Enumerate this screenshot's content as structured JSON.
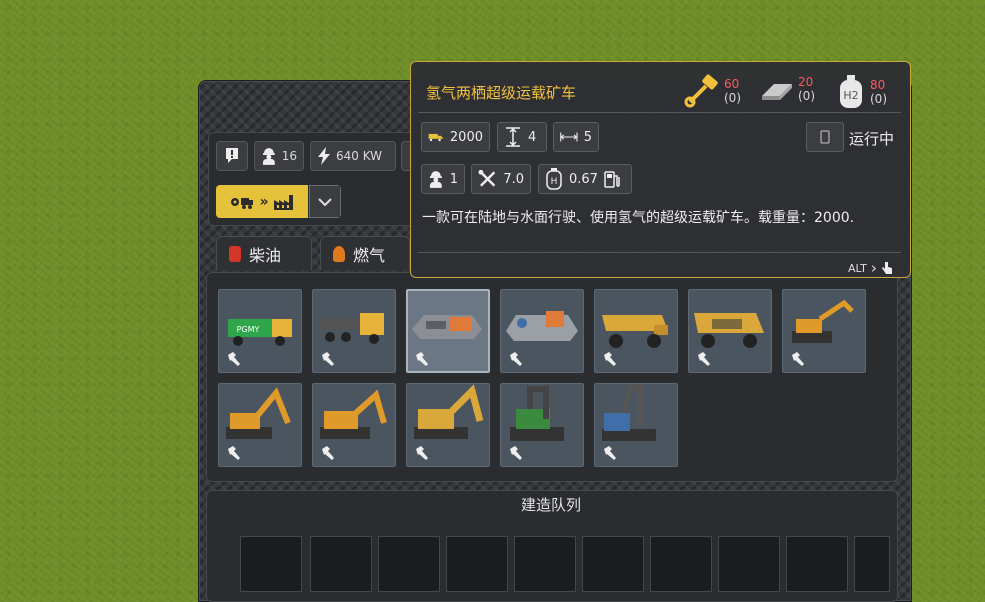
{
  "stats": {
    "workers": "16",
    "power": "640 KW"
  },
  "category": {
    "arrows": "»"
  },
  "tabs": [
    {
      "label": "柴油",
      "color": "#d2372a"
    },
    {
      "label": "燃气",
      "color": "#e07a1e"
    }
  ],
  "vehicles": [
    {
      "name": "truck-green",
      "icon": "hammer-icon",
      "side_text": "PGMY"
    },
    {
      "name": "truck-tractor",
      "icon": "hammer-icon"
    },
    {
      "name": "amphibious-hauler",
      "icon": "hammer-icon",
      "selected": true
    },
    {
      "name": "amphibious-hauler-large",
      "icon": "hammer-icon"
    },
    {
      "name": "mining-dump-truck",
      "icon": "hammer-icon"
    },
    {
      "name": "mining-dump-truck-large",
      "icon": "hammer-icon"
    },
    {
      "name": "excavator-small",
      "icon": "hammer-icon"
    },
    {
      "name": "excavator-tracked",
      "icon": "hammer-icon"
    },
    {
      "name": "excavator-medium",
      "icon": "hammer-icon"
    },
    {
      "name": "excavator-large",
      "icon": "hammer-icon"
    },
    {
      "name": "excavator-mega-green",
      "icon": "hammer-icon"
    },
    {
      "name": "excavator-mega-blue",
      "icon": "hammer-icon"
    }
  ],
  "queue": {
    "title": "建造队列"
  },
  "tooltip": {
    "title": "氢气两栖超级运载矿车",
    "costs": [
      {
        "icon": "piston-icon",
        "value": "60",
        "owned": "(0)"
      },
      {
        "icon": "steel-plate-icon",
        "value": "20",
        "owned": "(0)"
      },
      {
        "icon": "hydrogen-tank-icon",
        "value": "80",
        "owned": "(0)",
        "badge": "H2"
      }
    ],
    "capacity": "2000",
    "height": "4",
    "width": "5",
    "status": "运行中",
    "workers": "1",
    "maintenance": "7.0",
    "fuel": "0.67",
    "fuel_badge": "H",
    "description": "一款可在陆地与水面行驶、使用氢气的超级运载矿车。载重量：2000.",
    "alt_hint": "ALT",
    "alt_arrow": "›"
  },
  "colors": {
    "accent": "#f2c13b",
    "cost_red": "#ff5a5a",
    "panel": "#2a2c30"
  }
}
